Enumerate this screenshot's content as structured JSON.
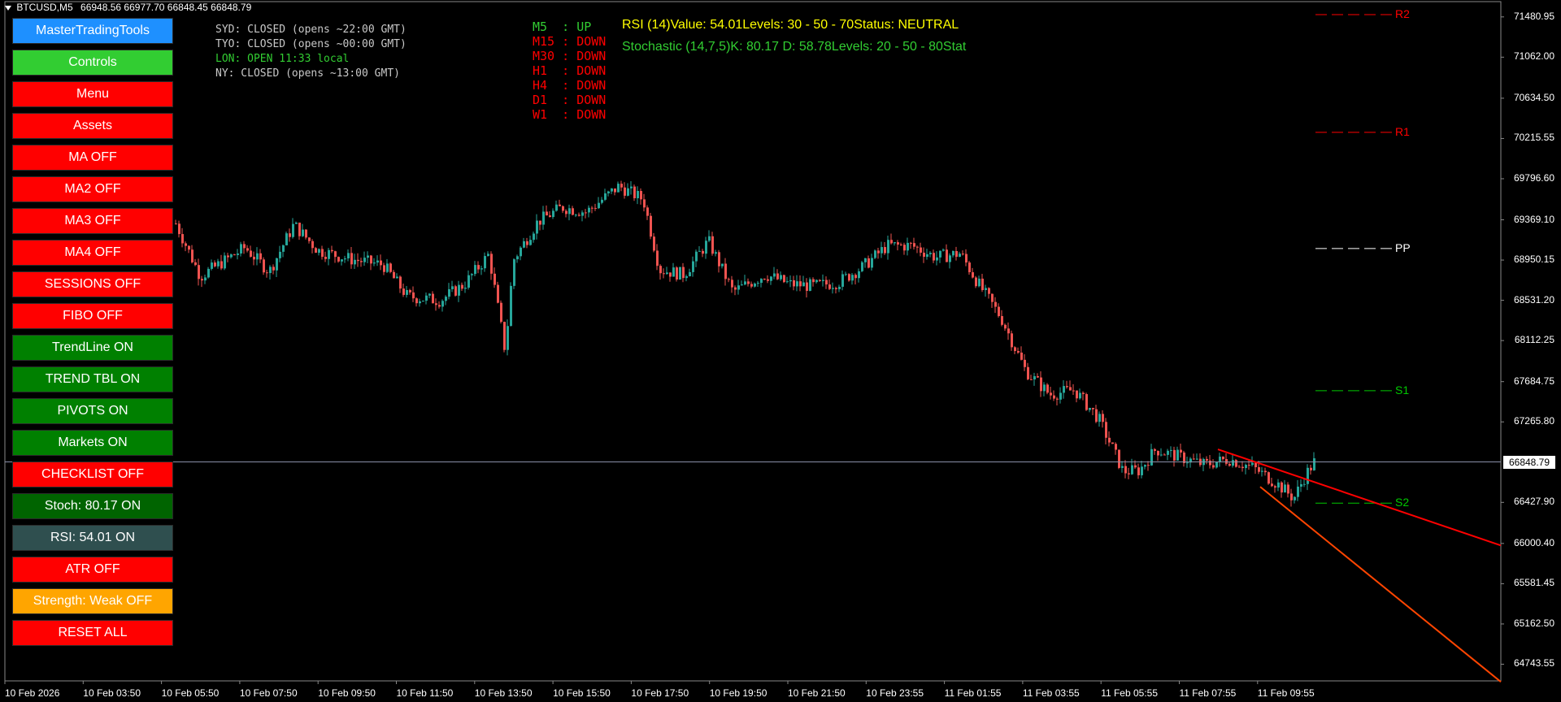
{
  "window": {
    "title": "BTCUSD,M5",
    "ohlc": "66948.56 66977.70 66848.45 66848.79"
  },
  "buttons": [
    {
      "label": "MasterTradingTools",
      "color": "#1e90ff"
    },
    {
      "label": "Controls",
      "color": "#32cd32"
    },
    {
      "label": "Menu",
      "color": "#ff0000"
    },
    {
      "label": "Assets",
      "color": "#ff0000"
    },
    {
      "label": "MA OFF",
      "color": "#ff0000"
    },
    {
      "label": "MA2 OFF",
      "color": "#ff0000"
    },
    {
      "label": "MA3 OFF",
      "color": "#ff0000"
    },
    {
      "label": "MA4 OFF",
      "color": "#ff0000"
    },
    {
      "label": "SESSIONS OFF",
      "color": "#ff0000"
    },
    {
      "label": "FIBO OFF",
      "color": "#ff0000"
    },
    {
      "label": "TrendLine ON",
      "color": "#008000"
    },
    {
      "label": "TREND TBL ON",
      "color": "#008000"
    },
    {
      "label": "PIVOTS ON",
      "color": "#008000"
    },
    {
      "label": "Markets ON",
      "color": "#008000"
    },
    {
      "label": "CHECKLIST OFF",
      "color": "#ff0000"
    },
    {
      "label": "Stoch: 80.17 ON",
      "color": "#006400"
    },
    {
      "label": "RSI: 54.01 ON",
      "color": "#2f4f4f"
    },
    {
      "label": "ATR OFF",
      "color": "#ff0000"
    },
    {
      "label": "Strength: Weak OFF",
      "color": "#ffa500"
    },
    {
      "label": "RESET ALL",
      "color": "#ff0000"
    }
  ],
  "sessions": [
    {
      "text": "SYD: CLOSED (opens ~22:00 GMT)",
      "color": "#c8c8c8"
    },
    {
      "text": "TYO: CLOSED (opens ~00:00 GMT)",
      "color": "#c8c8c8"
    },
    {
      "text": "LON: OPEN 11:33 local",
      "color": "#32cd32"
    },
    {
      "text": "NY: CLOSED (opens ~13:00 GMT)",
      "color": "#c8c8c8"
    }
  ],
  "timeframes": [
    {
      "tf": "M5 ",
      "dir": "UP",
      "color": "#32cd32"
    },
    {
      "tf": "M15",
      "dir": "DOWN",
      "color": "#ff0000"
    },
    {
      "tf": "M30",
      "dir": "DOWN",
      "color": "#ff0000"
    },
    {
      "tf": "H1 ",
      "dir": "DOWN",
      "color": "#ff0000"
    },
    {
      "tf": "H4 ",
      "dir": "DOWN",
      "color": "#ff0000"
    },
    {
      "tf": "D1 ",
      "dir": "DOWN",
      "color": "#ff0000"
    },
    {
      "tf": "W1 ",
      "dir": "DOWN",
      "color": "#ff0000"
    }
  ],
  "indicators": {
    "rsi": {
      "text": "RSI (14)Value: 54.01Levels: 30 - 50 - 70Status: NEUTRAL",
      "color": "#ffff00"
    },
    "stoch": {
      "text": "Stochastic (14,7,5)K: 80.17 D: 58.78Levels: 20 - 50 - 80Stat",
      "color": "#32cd32"
    }
  },
  "price_axis": {
    "labels": [
      "71480.95",
      "71062.00",
      "70634.50",
      "70215.55",
      "69796.60",
      "69369.10",
      "68950.15",
      "68531.20",
      "68112.25",
      "67684.75",
      "67265.80",
      "66427.90",
      "66000.40",
      "65581.45",
      "65162.50",
      "64743.55"
    ],
    "current": "66848.79",
    "range": [
      64570,
      71640
    ]
  },
  "time_axis": {
    "labels": [
      "10 Feb 2026",
      "10 Feb 03:50",
      "10 Feb 05:50",
      "10 Feb 07:50",
      "10 Feb 09:50",
      "10 Feb 11:50",
      "10 Feb 13:50",
      "10 Feb 15:50",
      "10 Feb 17:50",
      "10 Feb 19:50",
      "10 Feb 21:50",
      "10 Feb 23:55",
      "11 Feb 01:55",
      "11 Feb 03:55",
      "11 Feb 05:55",
      "11 Feb 07:55",
      "11 Feb 09:55"
    ]
  },
  "pivots": [
    {
      "label": "R2",
      "price": 71700,
      "color": "#ff0000"
    },
    {
      "label": "R1",
      "price": 70280,
      "color": "#ff0000"
    },
    {
      "label": "PP",
      "price": 69070,
      "color": "#ffffff"
    },
    {
      "label": "S1",
      "price": 67590,
      "color": "#00c800"
    },
    {
      "label": "S2",
      "price": 66420,
      "color": "#00c800"
    }
  ],
  "colors": {
    "bull_candle": "#26a69a",
    "bear_candle": "#ef5350",
    "trendline_upper": "#ff0000",
    "trendline_lower": "#ff4500",
    "grid": "#1a1a1a"
  }
}
